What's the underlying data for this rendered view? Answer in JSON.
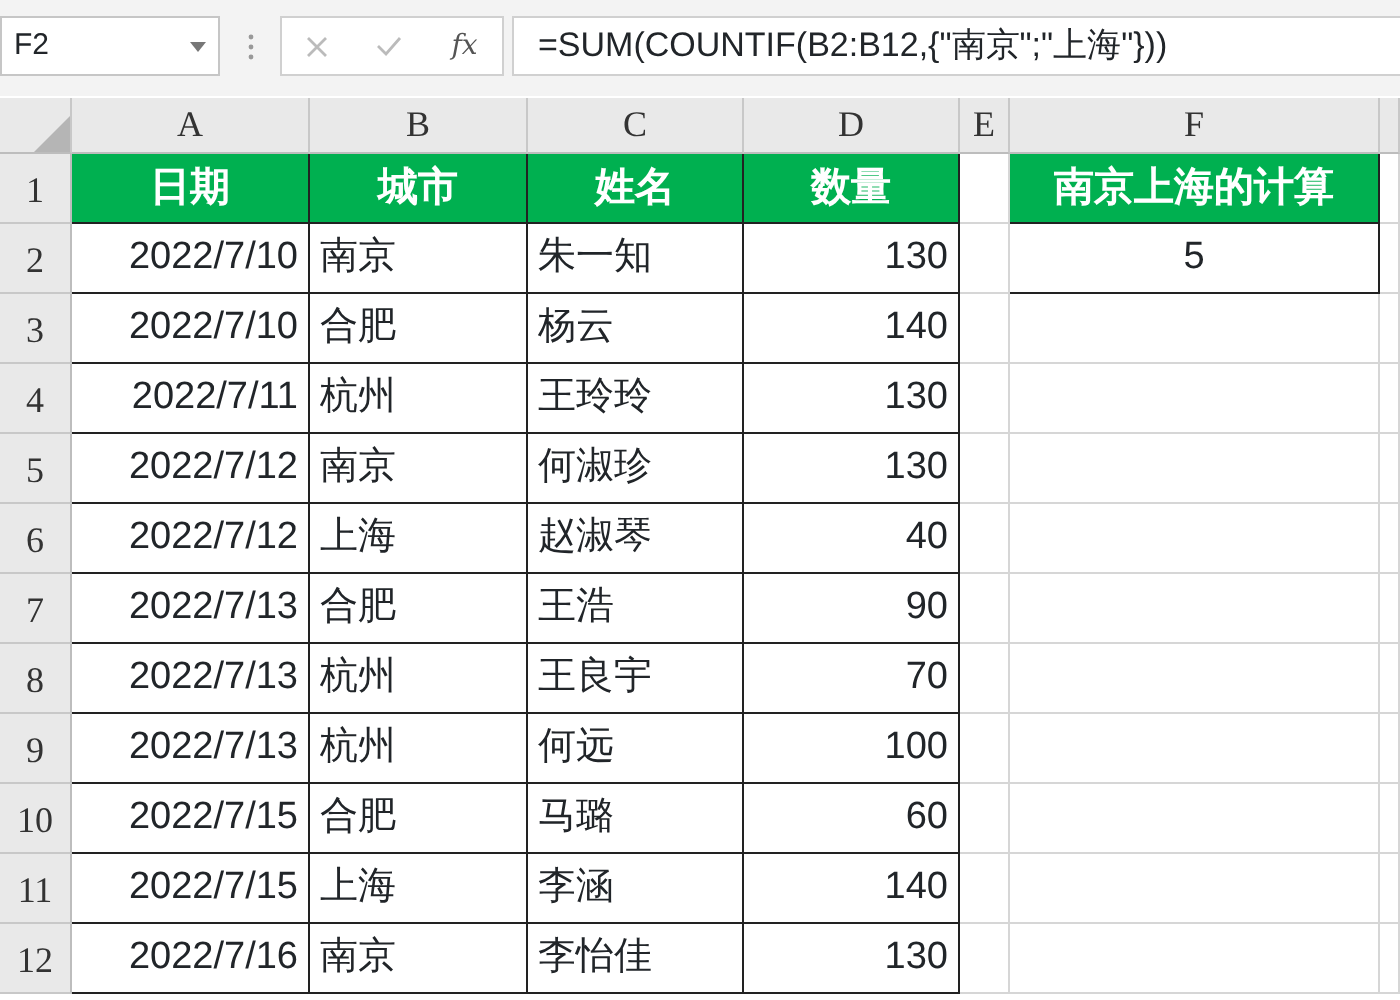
{
  "name_box": {
    "value": "F2"
  },
  "formula_bar": {
    "function_label": "fx",
    "formula": "=SUM(COUNTIF(B2:B12,{\"南京\";\"上海\"}))"
  },
  "sheet": {
    "columns": [
      "A",
      "B",
      "C",
      "D",
      "E",
      "F"
    ],
    "rows": [
      {
        "number": "1",
        "kind": "header",
        "cells": {
          "A": "日期",
          "B": "城市",
          "C": "姓名",
          "D": "数量",
          "F": "南京上海的计算"
        }
      },
      {
        "number": "2",
        "kind": "data",
        "cells": {
          "A": "2022/7/10",
          "B": "南京",
          "C": "朱一知",
          "D": "130",
          "F": "5"
        }
      },
      {
        "number": "3",
        "kind": "data",
        "cells": {
          "A": "2022/7/10",
          "B": "合肥",
          "C": "杨云",
          "D": "140"
        }
      },
      {
        "number": "4",
        "kind": "data",
        "cells": {
          "A": "2022/7/11",
          "B": "杭州",
          "C": "王玲玲",
          "D": "130"
        }
      },
      {
        "number": "5",
        "kind": "data",
        "cells": {
          "A": "2022/7/12",
          "B": "南京",
          "C": "何淑珍",
          "D": "130"
        }
      },
      {
        "number": "6",
        "kind": "data",
        "cells": {
          "A": "2022/7/12",
          "B": "上海",
          "C": "赵淑琴",
          "D": "40"
        }
      },
      {
        "number": "7",
        "kind": "data",
        "cells": {
          "A": "2022/7/13",
          "B": "合肥",
          "C": "王浩",
          "D": "90"
        }
      },
      {
        "number": "8",
        "kind": "data",
        "cells": {
          "A": "2022/7/13",
          "B": "杭州",
          "C": "王良宇",
          "D": "70"
        }
      },
      {
        "number": "9",
        "kind": "data",
        "cells": {
          "A": "2022/7/13",
          "B": "杭州",
          "C": "何远",
          "D": "100"
        }
      },
      {
        "number": "10",
        "kind": "data",
        "cells": {
          "A": "2022/7/15",
          "B": "合肥",
          "C": "马璐",
          "D": "60"
        }
      },
      {
        "number": "11",
        "kind": "data",
        "cells": {
          "A": "2022/7/15",
          "B": "上海",
          "C": "李涵",
          "D": "140"
        }
      },
      {
        "number": "12",
        "kind": "data",
        "cells": {
          "A": "2022/7/16",
          "B": "南京",
          "C": "李怡佳",
          "D": "130"
        }
      }
    ]
  }
}
